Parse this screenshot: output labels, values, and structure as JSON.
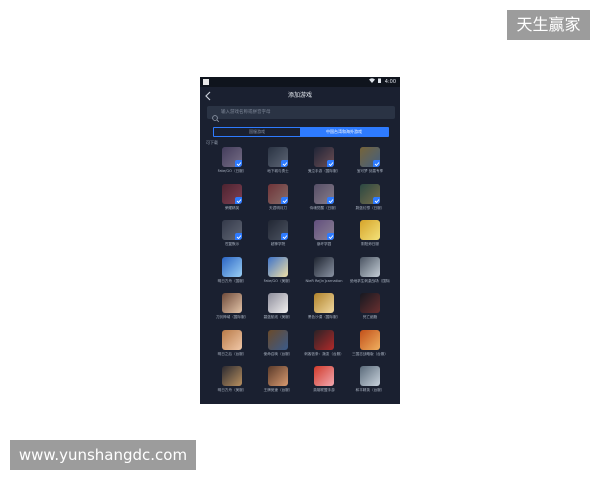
{
  "watermarks": {
    "top_right": "天生赢家",
    "bottom_left": "www.yunshangdc.com"
  },
  "status_bar": {
    "time": "4:00",
    "wifi_icon": "wifi-icon",
    "battery_icon": "battery-icon"
  },
  "header": {
    "title": "添加游戏",
    "back_icon": "back-arrow-icon"
  },
  "search": {
    "placeholder": "输入游戏名称或拼音字母"
  },
  "tabs": [
    {
      "label": "国服游戏",
      "active": false
    },
    {
      "label": "中国台湾和海外游戏",
      "active": true
    }
  ],
  "section_title": "可下载",
  "colors": {
    "accent": "#2e7bff",
    "background": "#1a2030",
    "search_bg": "#2a3344"
  },
  "games": [
    {
      "name": "Fate/GO（日服）",
      "selected": true,
      "c1": "#6b5a8a",
      "c2": "#c8b6d8"
    },
    {
      "name": "地下城与勇士",
      "selected": true,
      "c1": "#3d4a5e",
      "c2": "#9aa6b8"
    },
    {
      "name": "鬼泣手游（国际服）",
      "selected": true,
      "c1": "#2a2f48",
      "c2": "#b77b7b"
    },
    {
      "name": "宝可梦 剑盾专享",
      "selected": true,
      "c1": "#c7a24a",
      "c2": "#6a9ad0"
    },
    {
      "name": "荣耀精英",
      "selected": true,
      "c1": "#7a2d3a",
      "c2": "#d8607a"
    },
    {
      "name": "天涯明月刀",
      "selected": true,
      "c1": "#b84a4a",
      "c2": "#e8b2a2"
    },
    {
      "name": "侍魂觉醒（日服）",
      "selected": true,
      "c1": "#8c7a9e",
      "c2": "#e6d0dc"
    },
    {
      "name": "蔚蓝幻想（日服）",
      "selected": true,
      "c1": "#3d6e5c",
      "c2": "#c9b36a"
    },
    {
      "name": "苍翼默示",
      "selected": true,
      "c1": "#4e556a",
      "c2": "#a0a6b6"
    },
    {
      "name": "超神学院",
      "selected": true,
      "c1": "#2e3442",
      "c2": "#7a8494"
    },
    {
      "name": "崩坏学园",
      "selected": true,
      "c1": "#a27cc8",
      "c2": "#efd9ef"
    },
    {
      "name": "阴阳师日服",
      "selected": false,
      "c1": "#d6a42a",
      "c2": "#f3e27a"
    },
    {
      "name": "明日方舟（国服）",
      "selected": false,
      "c1": "#2a64c4",
      "c2": "#9bd0f5"
    },
    {
      "name": "Fate/GO（美服）",
      "selected": false,
      "c1": "#3d72c8",
      "c2": "#f0e0a8"
    },
    {
      "name": "NieR Re[in]carnation",
      "selected": false,
      "c1": "#1e2430",
      "c2": "#8a93a3"
    },
    {
      "name": "绝地求生刺激战场（国际服）",
      "selected": false,
      "c1": "#4a5462",
      "c2": "#c4cdd6"
    },
    {
      "name": "刀剑神域（国际服）",
      "selected": false,
      "c1": "#6e4a3a",
      "c2": "#e3c4a8"
    },
    {
      "name": "碧蓝航线（美服）",
      "selected": false,
      "c1": "#8c8c9a",
      "c2": "#f2f0f0"
    },
    {
      "name": "黑色沙漠（国际服）",
      "selected": false,
      "c1": "#b0822a",
      "c2": "#f0d8a0"
    },
    {
      "name": "死亡细胞",
      "selected": false,
      "c1": "#151820",
      "c2": "#6a3030"
    },
    {
      "name": "明日之后（台服）",
      "selected": false,
      "c1": "#b87a48",
      "c2": "#f0c8a8"
    },
    {
      "name": "使命召唤（台服）",
      "selected": false,
      "c1": "#6a4a2a",
      "c2": "#3a5a8a"
    },
    {
      "name": "刺客信条：叛变（台服）",
      "selected": false,
      "c1": "#2a2226",
      "c2": "#b02a2a"
    },
    {
      "name": "三国志战略版（台服）",
      "selected": false,
      "c1": "#c2501a",
      "c2": "#f0b060"
    },
    {
      "name": "明日方舟（美服）",
      "selected": false,
      "c1": "#2c2a30",
      "c2": "#b89060"
    },
    {
      "name": "王牌竞速（台服）",
      "selected": false,
      "c1": "#5a3a2a",
      "c2": "#d89a70"
    },
    {
      "name": "英雄联盟手游",
      "selected": false,
      "c1": "#d03a2a",
      "c2": "#f2a8b0"
    },
    {
      "name": "和平精英（台服）",
      "selected": false,
      "c1": "#5a6a7a",
      "c2": "#c8d2dc"
    }
  ]
}
